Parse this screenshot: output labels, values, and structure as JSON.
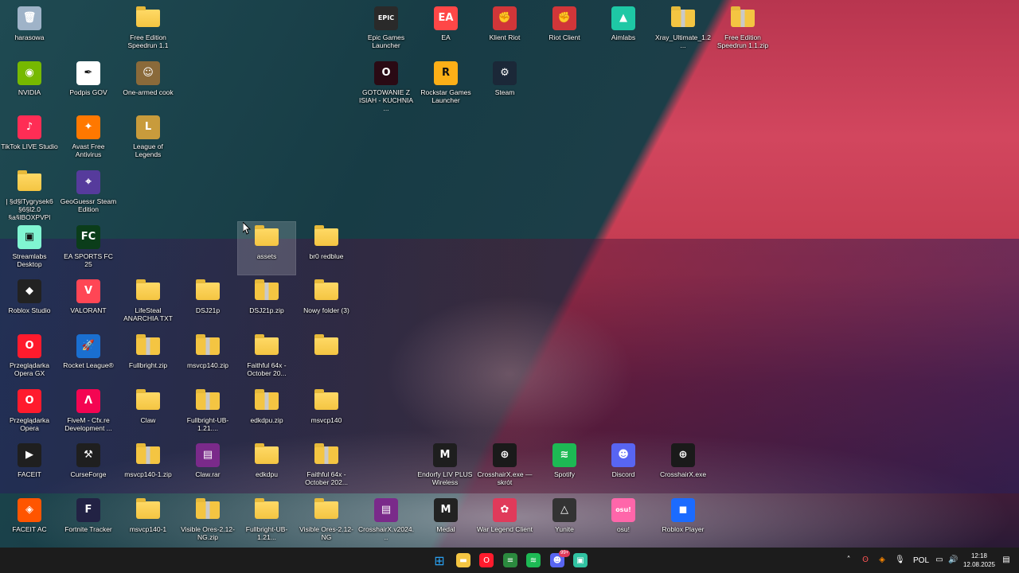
{
  "desktop": {
    "icons": [
      {
        "label": "harasowa",
        "icon": "recycle-bin-icon",
        "color": "#9fb3c8",
        "glyph": "🗑"
      },
      {
        "label": "Free Edition Speedrun 1.1",
        "icon": "folder-icon",
        "type": "folder"
      },
      {
        "label": "Epic Games Launcher",
        "icon": "epic-games-icon",
        "color": "#2a2a2a",
        "glyph": "EPIC"
      },
      {
        "label": "EA",
        "icon": "ea-icon",
        "color": "#ff4747",
        "glyph": "EA"
      },
      {
        "label": "Klient Riot",
        "icon": "riot-icon",
        "color": "#d13639",
        "glyph": "✊"
      },
      {
        "label": "Riot Client",
        "icon": "riot-icon",
        "color": "#d13639",
        "glyph": "✊"
      },
      {
        "label": "Aimlabs",
        "icon": "aimlabs-icon",
        "color": "#1ec8a5",
        "glyph": "▲"
      },
      {
        "label": "Xray_Ultimate_1.2...",
        "icon": "zip-folder-icon",
        "type": "zip"
      },
      {
        "label": "Free Edition Speedrun 1.1.zip",
        "icon": "zip-folder-icon",
        "type": "zip"
      },
      {
        "label": "NVIDIA",
        "icon": "nvidia-icon",
        "color": "#76b900",
        "glyph": "◉"
      },
      {
        "label": "Podpis GOV",
        "icon": "podpis-gov-icon",
        "color": "#ffffff",
        "glyph": "✒"
      },
      {
        "label": "One-armed cook",
        "icon": "one-armed-cook-icon",
        "color": "#8a6a3a",
        "glyph": "☺"
      },
      {
        "label": "GOTOWANIE Z ISIAH - KUCHNIA ...",
        "icon": "opera-gx-icon",
        "color": "#2a0a14",
        "glyph": "O"
      },
      {
        "label": "Rockstar Games Launcher",
        "icon": "rockstar-icon",
        "color": "#fcaf17",
        "glyph": "R"
      },
      {
        "label": "Steam",
        "icon": "steam-icon",
        "color": "#1b2838",
        "glyph": "⚙"
      },
      {
        "label": "TikTok LIVE Studio",
        "icon": "tiktok-icon",
        "color": "#ff2d55",
        "glyph": "♪"
      },
      {
        "label": "Avast Free Antivirus",
        "icon": "avast-icon",
        "color": "#ff7800",
        "glyph": "✦"
      },
      {
        "label": "League of Legends",
        "icon": "league-icon",
        "color": "#c89b3c",
        "glyph": "L"
      },
      {
        "label": "| §d§lTygrysek6 §6§l2.0 §a§lBOXPVP|",
        "icon": "folder-icon",
        "type": "folder"
      },
      {
        "label": "GeoGuessr Steam Edition",
        "icon": "geoguessr-icon",
        "color": "#563b9c",
        "glyph": "⌖"
      },
      {
        "label": "Streamlabs Desktop",
        "icon": "streamlabs-icon",
        "color": "#80f5d2",
        "glyph": "▣"
      },
      {
        "label": "EA SPORTS FC 25",
        "icon": "fc25-icon",
        "color": "#0b3d1a",
        "glyph": "FC"
      },
      {
        "label": "assets",
        "icon": "folder-icon",
        "type": "folder",
        "selected": true
      },
      {
        "label": "br0 redblue",
        "icon": "folder-icon",
        "type": "folder"
      },
      {
        "label": "Roblox Studio",
        "icon": "roblox-studio-icon",
        "color": "#222222",
        "glyph": "◆"
      },
      {
        "label": "VALORANT",
        "icon": "valorant-icon",
        "color": "#ff4655",
        "glyph": "V"
      },
      {
        "label": "LifeSteal ANARCHIA TXT",
        "icon": "folder-icon",
        "type": "folder"
      },
      {
        "label": "DSJ21p",
        "icon": "folder-icon",
        "type": "folder"
      },
      {
        "label": "DSJ21p.zip",
        "icon": "zip-folder-icon",
        "type": "zip"
      },
      {
        "label": "Nowy folder (3)",
        "icon": "folder-icon",
        "type": "folder"
      },
      {
        "label": "Przeglądarka Opera GX",
        "icon": "opera-gx-icon",
        "color": "#ff1b2d",
        "glyph": "O"
      },
      {
        "label": "Rocket League®",
        "icon": "rocket-league-icon",
        "color": "#1a6fd0",
        "glyph": "🚀"
      },
      {
        "label": "Fullbright.zip",
        "icon": "zip-folder-icon",
        "type": "zip"
      },
      {
        "label": "msvcp140.zip",
        "icon": "zip-folder-icon",
        "type": "zip"
      },
      {
        "label": "Faithful 64x - October 20...",
        "icon": "folder-icon",
        "type": "folder"
      },
      {
        "label": "",
        "icon": "folder-icon",
        "type": "folder"
      },
      {
        "label": "Przeglądarka Opera",
        "icon": "opera-icon",
        "color": "#ff1b2d",
        "glyph": "O"
      },
      {
        "label": "FiveM - Cfx.re Development ...",
        "icon": "fivem-icon",
        "color": "#f40552",
        "glyph": "Λ"
      },
      {
        "label": "Claw",
        "icon": "folder-icon",
        "type": "folder"
      },
      {
        "label": "Fullbright-UB-1.21....",
        "icon": "zip-folder-icon",
        "type": "zip"
      },
      {
        "label": "edkdpu.zip",
        "icon": "zip-folder-icon",
        "type": "zip"
      },
      {
        "label": "msvcp140",
        "icon": "folder-icon",
        "type": "folder"
      },
      {
        "label": "Endorfy LIV PLUS Wireless",
        "icon": "endorfy-icon",
        "color": "#1e1e1e",
        "glyph": "M"
      },
      {
        "label": "CrosshairX.exe — skrót",
        "icon": "crosshairx-icon",
        "color": "#1a1a1a",
        "glyph": "⊕"
      },
      {
        "label": "Spotify",
        "icon": "spotify-icon",
        "color": "#1db954",
        "glyph": "≋"
      },
      {
        "label": "Discord",
        "icon": "discord-icon",
        "color": "#5865f2",
        "glyph": "☻"
      },
      {
        "label": "CrosshairX.exe",
        "icon": "crosshairx-icon",
        "color": "#1a1a1a",
        "glyph": "⊕"
      },
      {
        "label": "FACEIT",
        "icon": "faceit-icon",
        "color": "#1f1f1f",
        "glyph": "▶"
      },
      {
        "label": "CurseForge",
        "icon": "curseforge-icon",
        "color": "#1f1f1f",
        "glyph": "⚒"
      },
      {
        "label": "msvcp140-1.zip",
        "icon": "zip-folder-icon",
        "type": "zip"
      },
      {
        "label": "Claw.rar",
        "icon": "winrar-icon",
        "color": "#7a2a8a",
        "glyph": "▤"
      },
      {
        "label": "edkdpu",
        "icon": "folder-icon",
        "type": "folder"
      },
      {
        "label": "Faithful 64x - October 202...",
        "icon": "zip-folder-icon",
        "type": "zip"
      },
      {
        "label": "FACEIT AC",
        "icon": "faceit-ac-icon",
        "color": "#ff5500",
        "glyph": "◈"
      },
      {
        "label": "Fortnite Tracker",
        "icon": "fortnite-tracker-icon",
        "color": "#222244",
        "glyph": "F"
      },
      {
        "label": "msvcp140-1",
        "icon": "folder-icon",
        "type": "folder"
      },
      {
        "label": "Visible Ores-2.12-NG.zip",
        "icon": "zip-folder-icon",
        "type": "zip"
      },
      {
        "label": "Fullbright-UB-1.21...",
        "icon": "folder-icon",
        "type": "folder"
      },
      {
        "label": "Visible Ores-2.12-NG",
        "icon": "folder-icon",
        "type": "folder"
      },
      {
        "label": "CrosshairX.v2024...",
        "icon": "winrar-icon",
        "color": "#7a2a8a",
        "glyph": "▤"
      },
      {
        "label": "Medal",
        "icon": "medal-icon",
        "color": "#222222",
        "glyph": "M"
      },
      {
        "label": "War Legend Client",
        "icon": "war-legend-icon",
        "color": "#e03a5a",
        "glyph": "✿"
      },
      {
        "label": "Yunite",
        "icon": "yunite-icon",
        "color": "#333333",
        "glyph": "△"
      },
      {
        "label": "osu!",
        "icon": "osu-icon",
        "color": "#ff66aa",
        "glyph": "osu!"
      },
      {
        "label": "Roblox Player",
        "icon": "roblox-icon",
        "color": "#1b6bff",
        "glyph": "◼"
      }
    ]
  },
  "taskbar": {
    "apps": [
      {
        "name": "start-button",
        "glyph": "⊞",
        "color": "#2aa0f0"
      },
      {
        "name": "file-explorer-icon",
        "glyph": "▬",
        "color": "#f4c542"
      },
      {
        "name": "opera-gx-taskbar-icon",
        "glyph": "O",
        "color": "#ff1b2d"
      },
      {
        "name": "nvidia-app-taskbar-icon",
        "glyph": "≡",
        "color": "#2b8a3e"
      },
      {
        "name": "spotify-taskbar-icon",
        "glyph": "≋",
        "color": "#1db954"
      },
      {
        "name": "discord-taskbar-icon",
        "glyph": "☻",
        "color": "#5865f2"
      },
      {
        "name": "streamlabs-taskbar-icon",
        "glyph": "▣",
        "color": "#31c3a2"
      }
    ],
    "discord_badge": "99+",
    "language": "POL",
    "time": "12:18",
    "date": "12.08.2025"
  }
}
